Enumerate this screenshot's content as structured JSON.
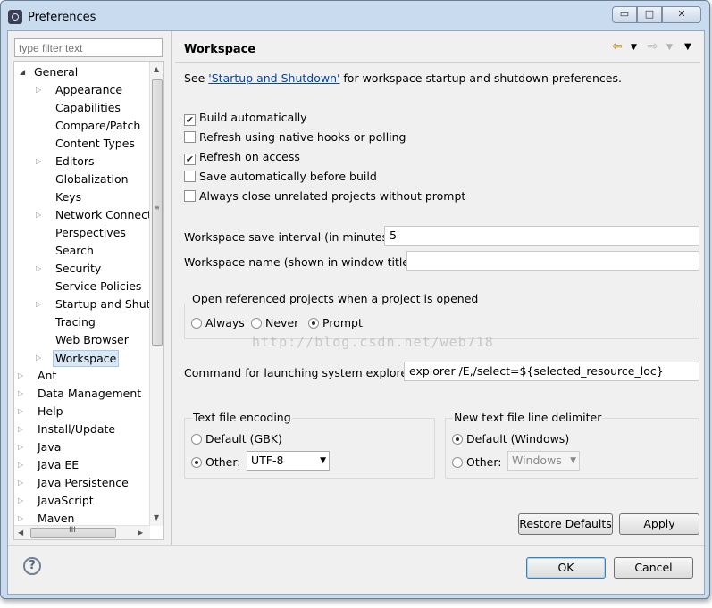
{
  "window": {
    "title": "Preferences",
    "controls": {
      "minimize": "▭",
      "maximize": "□",
      "close": "✕"
    }
  },
  "filter": {
    "placeholder": "type filter text"
  },
  "tree": {
    "items": [
      {
        "label": "General",
        "expanded": true
      },
      {
        "label": "Appearance",
        "expandable": true
      },
      {
        "label": "Capabilities"
      },
      {
        "label": "Compare/Patch"
      },
      {
        "label": "Content Types"
      },
      {
        "label": "Editors",
        "expandable": true
      },
      {
        "label": "Globalization"
      },
      {
        "label": "Keys"
      },
      {
        "label": "Network Connecti",
        "expandable": true
      },
      {
        "label": "Perspectives"
      },
      {
        "label": "Search"
      },
      {
        "label": "Security",
        "expandable": true
      },
      {
        "label": "Service Policies"
      },
      {
        "label": "Startup and Shutd",
        "expandable": true
      },
      {
        "label": "Tracing"
      },
      {
        "label": "Web Browser"
      },
      {
        "label": "Workspace",
        "expandable": true,
        "selected": true
      },
      {
        "label": "Ant",
        "expandable": true
      },
      {
        "label": "Data Management",
        "expandable": true
      },
      {
        "label": "Help",
        "expandable": true
      },
      {
        "label": "Install/Update",
        "expandable": true
      },
      {
        "label": "Java",
        "expandable": true
      },
      {
        "label": "Java EE",
        "expandable": true
      },
      {
        "label": "Java Persistence",
        "expandable": true
      },
      {
        "label": "JavaScript",
        "expandable": true
      },
      {
        "label": "Maven",
        "expandable": true
      }
    ],
    "hscroll_grip": "III",
    "vscroll_grip": "≡"
  },
  "page": {
    "title": "Workspace",
    "intro_prefix": "See ",
    "intro_link": "'Startup and Shutdown'",
    "intro_suffix": " for workspace startup and shutdown preferences.",
    "checkboxes": [
      {
        "label": "Build automatically",
        "checked": true
      },
      {
        "label": "Refresh using native hooks or polling",
        "checked": false
      },
      {
        "label": "Refresh on access",
        "checked": true
      },
      {
        "label": "Save automatically before build",
        "checked": false
      },
      {
        "label": "Always close unrelated projects without prompt",
        "checked": false
      }
    ],
    "save_interval_label": "Workspace save interval (in minutes):",
    "save_interval_value": "5",
    "workspace_name_label": "Workspace name (shown in window title):",
    "workspace_name_value": "",
    "open_projects": {
      "title": "Open referenced projects when a project is opened",
      "options": [
        "Always",
        "Never",
        "Prompt"
      ],
      "selected": "Prompt"
    },
    "explorer_label": "Command for launching system explorer:",
    "explorer_value": "explorer /E,/select=${selected_resource_loc}",
    "encoding": {
      "title": "Text file encoding",
      "default_label": "Default (GBK)",
      "other_label": "Other:",
      "other_value": "UTF-8",
      "selected": "Other"
    },
    "delimiter": {
      "title": "New text file line delimiter",
      "default_label": "Default (Windows)",
      "other_label": "Other:",
      "other_value": "Windows",
      "selected": "Default"
    },
    "restore_defaults": "Restore Defaults",
    "apply": "Apply"
  },
  "footer": {
    "ok": "OK",
    "cancel": "Cancel",
    "help": "?"
  },
  "watermark": "http://blog.csdn.net/web718"
}
